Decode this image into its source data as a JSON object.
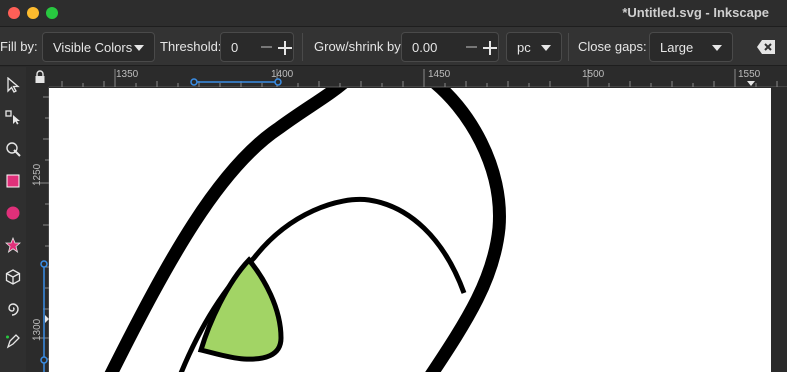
{
  "window": {
    "title": "*Untitled.svg - Inkscape"
  },
  "toolbar": {
    "fill_by_label": "Fill by:",
    "fill_by_value": "Visible Colors",
    "threshold_label": "Threshold:",
    "threshold_value": "0",
    "grow_label": "Grow/shrink by:",
    "grow_value": "0.00",
    "unit_value": "pc",
    "close_gaps_label": "Close gaps:",
    "close_gaps_value": "Large",
    "clear_icon": "backspace-icon"
  },
  "tools": [
    {
      "name": "selector-tool",
      "icon": "arrow-cursor-icon"
    },
    {
      "name": "node-tool",
      "icon": "node-edit-icon"
    },
    {
      "name": "tweak-tool",
      "icon": "tweak-icon"
    },
    {
      "name": "rect-tool",
      "icon": "rectangle-icon"
    },
    {
      "name": "circle-tool",
      "icon": "circle-icon"
    },
    {
      "name": "star-tool",
      "icon": "star-icon"
    },
    {
      "name": "box3d-tool",
      "icon": "cube-icon"
    },
    {
      "name": "spiral-tool",
      "icon": "spiral-icon"
    },
    {
      "name": "pen-tool",
      "icon": "pen-icon"
    }
  ],
  "rulers": {
    "top_labels": [
      "1350",
      "1400",
      "1450",
      "1500",
      "1550"
    ],
    "left_labels": [
      "1250",
      "1300"
    ]
  },
  "colors": {
    "accent_magenta": "#e0307a",
    "fill_green": "#a2d465",
    "guide_blue": "#3a8ee6"
  }
}
